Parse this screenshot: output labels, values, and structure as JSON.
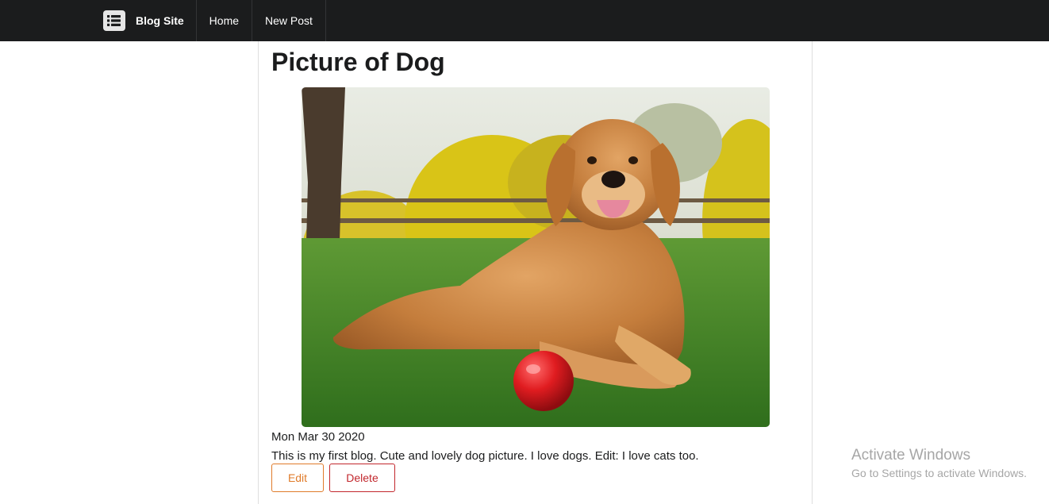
{
  "navbar": {
    "brand_icon": "list-icon",
    "brand_label": "Blog Site",
    "items": [
      {
        "label": "Home"
      },
      {
        "label": "New Post"
      }
    ]
  },
  "post": {
    "title": "Picture of Dog",
    "image_alt": "golden retriever lying on grass with a red ball",
    "date": "Mon Mar 30 2020",
    "body": "This is my first blog. Cute and lovely dog picture. I love dogs. Edit: I love cats too.",
    "actions": {
      "edit_label": "Edit",
      "delete_label": "Delete"
    }
  },
  "watermark": {
    "title": "Activate Windows",
    "subtitle": "Go to Settings to activate Windows."
  },
  "colors": {
    "navbar_bg": "#1b1c1d",
    "edit_accent": "#e07b2a",
    "delete_accent": "#c2272d"
  }
}
